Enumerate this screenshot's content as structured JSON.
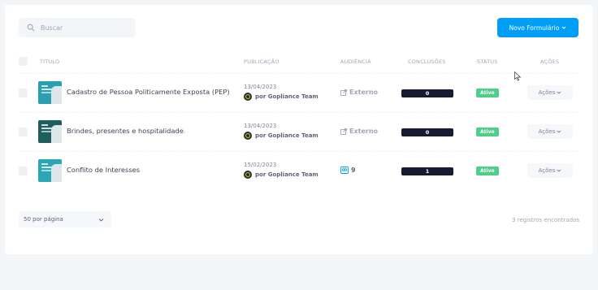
{
  "search": {
    "placeholder": "Buscar"
  },
  "new_form_button": {
    "label": "Novo Formulário"
  },
  "columns": {
    "title": "TÍTULO",
    "publication": "PUBLICAÇÃO",
    "audience": "AUDIÊNCIA",
    "completions": "CONCLUSÕES",
    "status": "STATUS",
    "actions": "AÇÕES"
  },
  "rows": [
    {
      "title": "Cadastro de Pessoa Politicamente Exposta (PEP)",
      "date": "13/04/2023",
      "by": "por Gopliance Team",
      "audience": "Externo",
      "audience_icon": "external-link-icon",
      "completions": "0",
      "status": "Ativo",
      "actions": "Ações",
      "thumb_color": "#2a9fb0"
    },
    {
      "title": "Brindes, presentes e hospitalidade",
      "date": "13/04/2023",
      "by": "por Gopliance Team",
      "audience": "Externo",
      "audience_icon": "external-link-icon",
      "completions": "0",
      "status": "Ativo",
      "actions": "Ações",
      "thumb_color": "#1f5e5f"
    },
    {
      "title": "Conflito de Interesses",
      "date": "15/02/2023",
      "by": "por Gopliance Team",
      "audience": "9",
      "audience_icon": "users-group-icon",
      "completions": "1",
      "status": "Ativo",
      "actions": "Ações",
      "thumb_color": "#2aa6b4"
    }
  ],
  "pagination": {
    "per_page": "50 por página"
  },
  "record_count": "3 registros encontrados",
  "colors": {
    "primary": "#009ef7",
    "success": "#50cd89",
    "dark": "#181c32"
  }
}
